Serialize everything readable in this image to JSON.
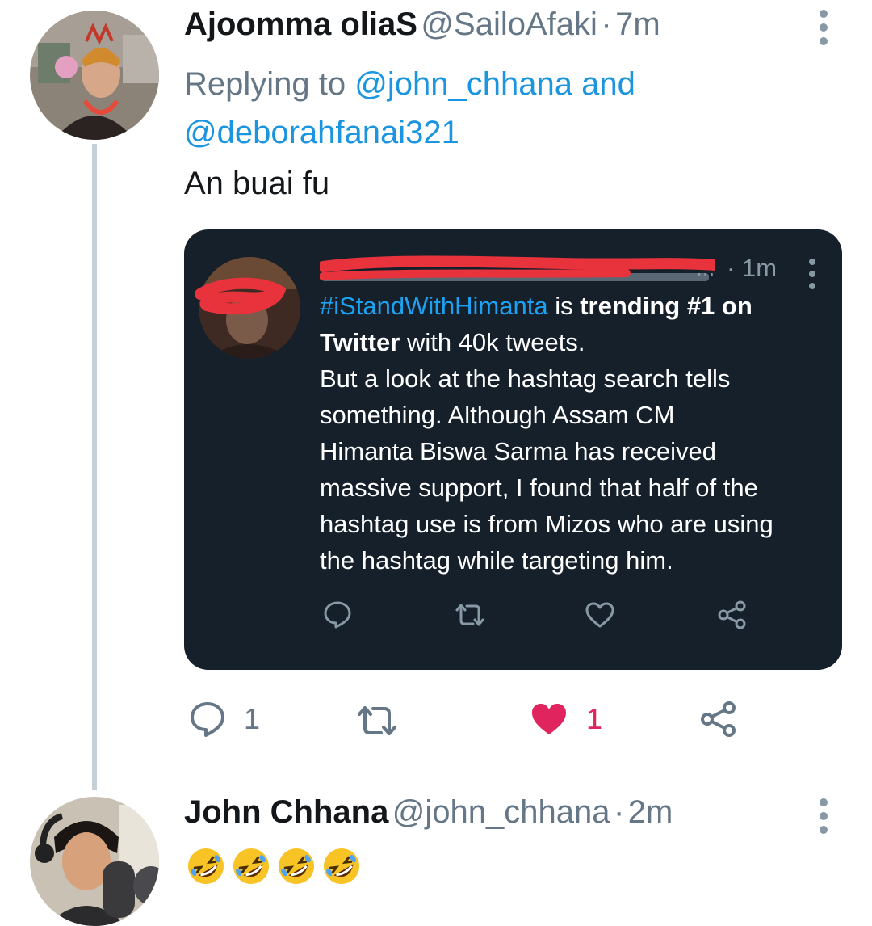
{
  "tweet": {
    "author_name": "Ajoomma oliaS",
    "author_handle": "@SailoAfaki",
    "separator": "·",
    "time": "7m",
    "replying_prefix": "Replying to",
    "reply_handle_1": "@john_chhana",
    "reply_and": "and",
    "reply_handle_2": "@deborahfanai321",
    "text": "An buai fu",
    "reply_count": "1",
    "like_count": "1",
    "liked": true
  },
  "quote": {
    "time": "1m",
    "separator": "·",
    "hashtag": "#iStandWithHimanta",
    "seg_is": "is",
    "seg_trending": "trending #1 on",
    "seg_twitter": "Twitter",
    "seg_with": "with 40k tweets.",
    "line_1": "But a look at the hashtag search tells",
    "line_2": "something. Although Assam CM",
    "line_3": "Himanta Biswa Sarma has received",
    "line_4": "massive support, I found that half of the",
    "line_5": "hashtag use is from Mizos who are using",
    "line_6": "the hashtag while targeting him."
  },
  "reply": {
    "author_name": "John Chhana",
    "author_handle": "@john_chhana",
    "separator": "·",
    "time": "2m",
    "emoji_count": 4
  },
  "icons": {
    "reply": "speech-bubble-icon",
    "retweet": "retweet-icon",
    "like": "heart-icon",
    "share": "share-icon",
    "more": "more-vertical-icon",
    "emoji": "rolling-laughing-face-emoji"
  },
  "colors": {
    "link": "#1b95e0",
    "like": "#e0245e",
    "muted": "#657786",
    "quote_bg": "#15202b",
    "redaction": "#e8323c"
  }
}
